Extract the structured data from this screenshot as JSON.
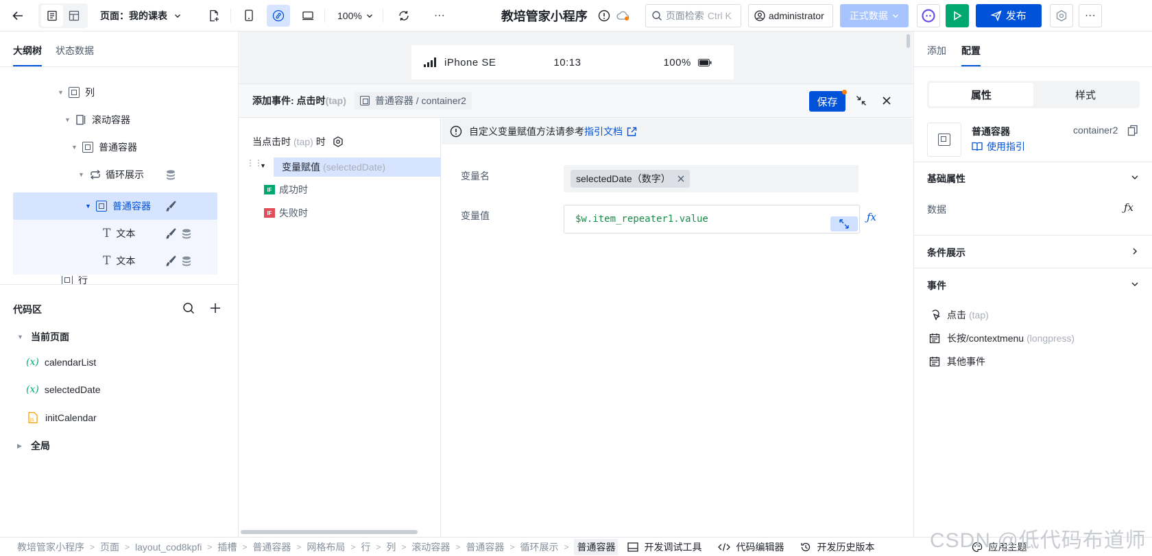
{
  "topbar": {
    "page_label": "页面：我的课表",
    "zoom": "100%",
    "app_title": "教培管家小程序",
    "search_placeholder": "页面检索",
    "search_shortcut": "Ctrl K",
    "user": "administrator",
    "env": "正式数据",
    "publish": "发布"
  },
  "left": {
    "tabs": [
      "大纲树",
      "状态数据"
    ],
    "tree": [
      {
        "label": "列"
      },
      {
        "label": "滚动容器"
      },
      {
        "label": "普通容器"
      },
      {
        "label": "循环展示"
      },
      {
        "label": "普通容器"
      },
      {
        "label": "文本"
      },
      {
        "label": "文本"
      },
      {
        "label": "行"
      }
    ],
    "code_title": "代码区",
    "code_groups": [
      "当前页面",
      "全局"
    ],
    "code_items": [
      "calendarList",
      "selectedDate",
      "initCalendar"
    ]
  },
  "phone": {
    "device": "iPhone SE",
    "time": "10:13",
    "battery": "100%"
  },
  "event": {
    "title": "添加事件: 点击时",
    "title_tap": "(tap)",
    "crumb": "普通容器 / container2",
    "save": "保存",
    "trigger_label": "当点击时",
    "trigger_tap": "(tap)",
    "trigger_suffix": "时",
    "action_label": "变量赋值",
    "action_sub": "(selectedDate)",
    "success": "成功时",
    "fail": "失败时",
    "notice": "自定义变量赋值方法请参考",
    "notice_link": "指引文档",
    "var_name_label": "变量名",
    "var_name_value": "selectedDate（数字）",
    "var_value_label": "变量值",
    "var_value": "$w.item_repeater1.value"
  },
  "right": {
    "tabs": [
      "添加",
      "配置"
    ],
    "seg": [
      "属性",
      "样式"
    ],
    "comp_name": "普通容器",
    "comp_id": "container2",
    "guide": "使用指引",
    "basic": "基础属性",
    "data_label": "数据",
    "cond": "条件展示",
    "events": "事件",
    "ev_tap": "点击",
    "ev_tap_sub": "(tap)",
    "ev_long": "长按/contextmenu",
    "ev_long_sub": "(longpress)",
    "ev_other": "其他事件"
  },
  "bottom": {
    "breadcrumb": [
      "教培管家小程序",
      "页面",
      "layout_cod8kpfi",
      "插槽",
      "普通容器",
      "网格布局",
      "行",
      "列",
      "滚动容器",
      "普通容器",
      "循环展示",
      "普通容器"
    ],
    "tools": [
      "开发调试工具",
      "代码编辑器",
      "开发历史版本",
      "应用主题"
    ],
    "watermark": "CSDN @低代码布道师"
  }
}
